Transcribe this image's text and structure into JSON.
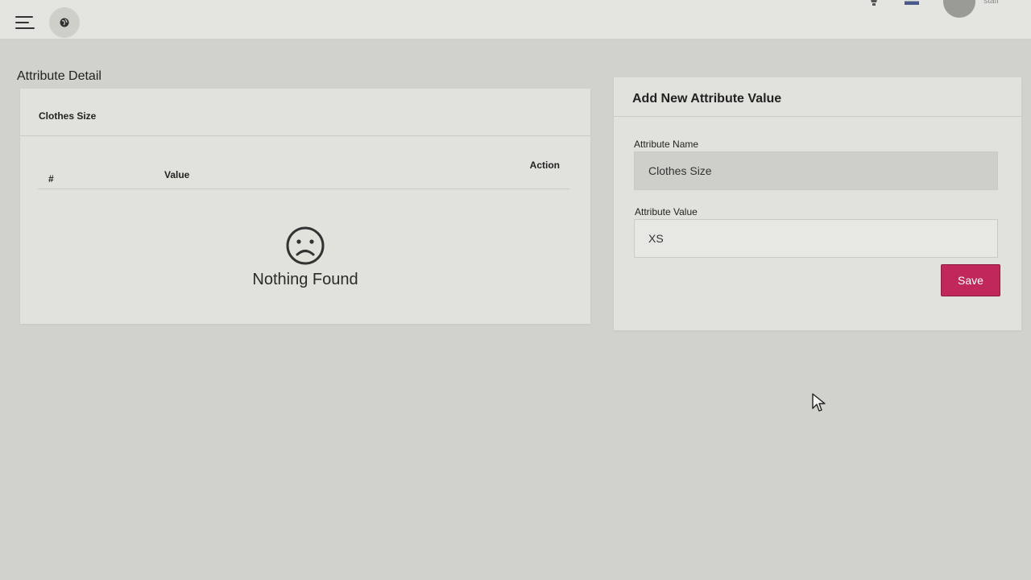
{
  "header": {
    "menu_icon": "hamburger-icon",
    "globe_icon": "globe-icon",
    "notification_icon": "bell-icon",
    "language_icon": "flag-icon",
    "user_label": "staff"
  },
  "page": {
    "title": "Attribute Detail"
  },
  "attribute_list": {
    "title": "Clothes Size",
    "columns": {
      "number": "#",
      "value": "Value",
      "action": "Action"
    },
    "empty_icon": "sad-face-icon",
    "empty_text": "Nothing Found"
  },
  "form": {
    "title": "Add New Attribute Value",
    "name_label": "Attribute Name",
    "name_value": "Clothes Size",
    "value_label": "Attribute Value",
    "value_value": "XS",
    "save_label": "Save"
  },
  "colors": {
    "accent": "#c0275a",
    "background": "#d2d2cd",
    "card": "#e2e2dd"
  }
}
